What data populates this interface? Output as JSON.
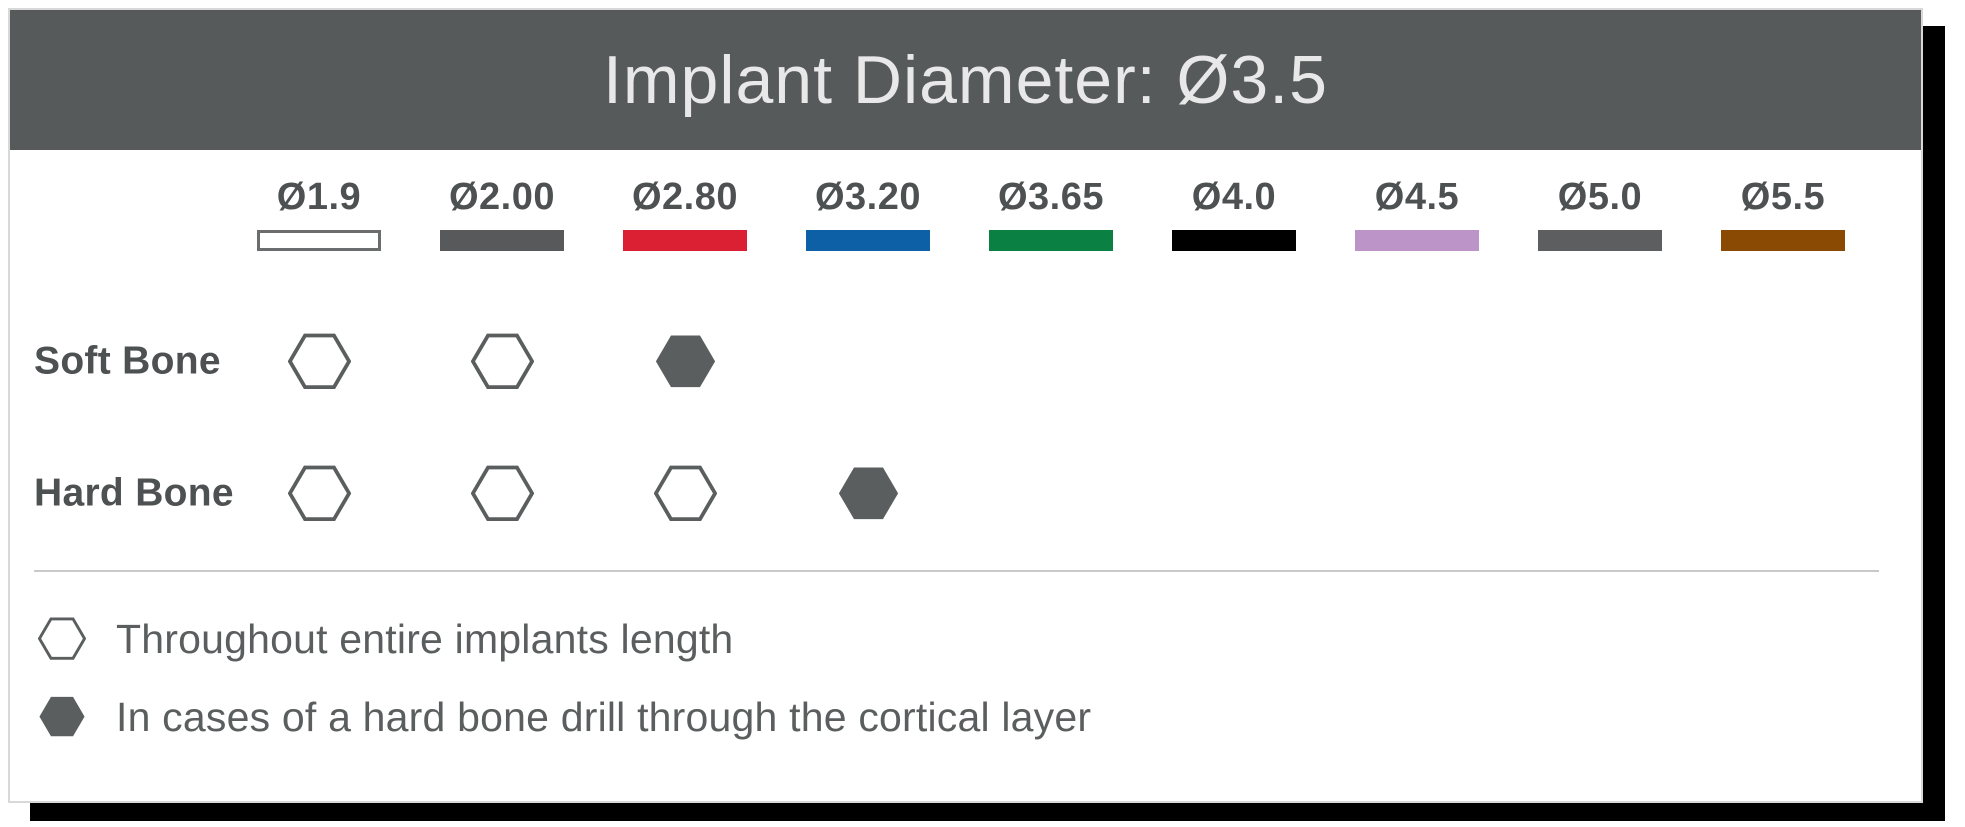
{
  "header": {
    "title": "Implant Diameter: Ø3.5",
    "background_color": "#575A5B",
    "text_color": "#E8E8E8"
  },
  "columns": [
    {
      "label": "Ø1.9",
      "color": "#FFFFFF",
      "border_color": "#6A6C6D"
    },
    {
      "label": "Ø2.00",
      "color": "#57595A",
      "border_color": "#57595A"
    },
    {
      "label": "Ø2.80",
      "color": "#DC2034",
      "border_color": "#DC2034"
    },
    {
      "label": "Ø3.20",
      "color": "#0D5FA6",
      "border_color": "#0D5FA6"
    },
    {
      "label": "Ø3.65",
      "color": "#0A8043",
      "border_color": "#0A8043"
    },
    {
      "label": "Ø4.0",
      "color": "#000000",
      "border_color": "#000000"
    },
    {
      "label": "Ø4.5",
      "color": "#BC94C8",
      "border_color": "#BC94C8"
    },
    {
      "label": "Ø5.0",
      "color": "#5C5E5F",
      "border_color": "#5C5E5F"
    },
    {
      "label": "Ø5.5",
      "color": "#8A4A03",
      "border_color": "#8A4A03"
    }
  ],
  "rows": [
    {
      "label": "Soft Bone",
      "cells": [
        "outline",
        "outline",
        "filled",
        "none",
        "none",
        "none",
        "none",
        "none",
        "none"
      ]
    },
    {
      "label": "Hard Bone",
      "cells": [
        "outline",
        "outline",
        "outline",
        "filled",
        "none",
        "none",
        "none",
        "none",
        "none"
      ]
    }
  ],
  "legend": [
    {
      "marker": "outline",
      "text": "Throughout entire implants length"
    },
    {
      "marker": "filled",
      "text": "In cases of a hard bone drill through the cortical layer"
    }
  ],
  "marker_colors": {
    "outline_stroke": "#5B5E5F",
    "fill": "#5B5E5F"
  },
  "chart_data": {
    "type": "table",
    "title": "Implant Diameter: Ø3.5",
    "categories": [
      "Ø1.9",
      "Ø2.00",
      "Ø2.80",
      "Ø3.20",
      "Ø3.65",
      "Ø4.0",
      "Ø4.5",
      "Ø5.0",
      "Ø5.5"
    ],
    "series": [
      {
        "name": "Soft Bone",
        "values": [
          "outline",
          "outline",
          "filled",
          "",
          "",
          "",
          "",
          "",
          ""
        ]
      },
      {
        "name": "Hard Bone",
        "values": [
          "outline",
          "outline",
          "outline",
          "filled",
          "",
          "",
          "",
          "",
          ""
        ]
      }
    ],
    "legend_position": "bottom",
    "grid": false
  }
}
